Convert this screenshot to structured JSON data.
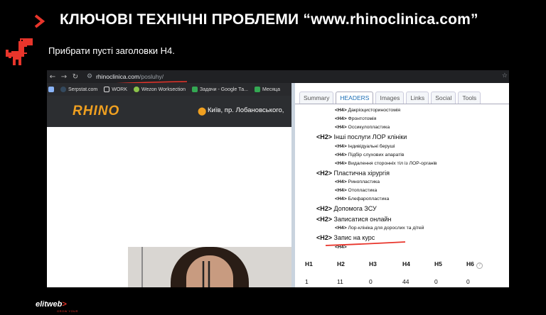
{
  "slide": {
    "title": "КЛЮЧОВІ ТЕХНІЧНІ ПРОБЛЕМИ “www.rhinoclinica.com”",
    "subtitle": "Прибрати пусті заголовки H4.",
    "accent_color": "#e8352b"
  },
  "browser": {
    "url_host": "rhinoclinica.com",
    "url_path": "/posluhy/",
    "bookmarks": [
      "Serpstat.com",
      "WORK",
      "Wezon Worksection",
      "Задачи - Google Та...",
      "Месяца"
    ]
  },
  "site": {
    "logo": "RHINO",
    "address": "Київ, пр. Лобановського,"
  },
  "seo_panel": {
    "tabs": [
      "Summary",
      "HEADERS",
      "Images",
      "Links",
      "Social",
      "Tools"
    ],
    "active_tab": "HEADERS",
    "headings": [
      {
        "level": "H4",
        "text": "Дакріоцисториностомія"
      },
      {
        "level": "H4",
        "text": "Фронтотомія"
      },
      {
        "level": "H4",
        "text": "Оссикулопластика"
      },
      {
        "level": "H2",
        "text": "Інші послуги ЛОР клініки"
      },
      {
        "level": "H4",
        "text": "Індивідуальні беруші"
      },
      {
        "level": "H4",
        "text": "Підбір слухових апаратів"
      },
      {
        "level": "H4",
        "text": "Видалення сторонніх тіл із ЛОР-органів"
      },
      {
        "level": "H2",
        "text": "Пластична хірургія"
      },
      {
        "level": "H4",
        "text": "Ринопластика"
      },
      {
        "level": "H4",
        "text": "Отопластика"
      },
      {
        "level": "H4",
        "text": "Блефаропластика"
      },
      {
        "level": "H2",
        "text": "Допомога ЗСУ"
      },
      {
        "level": "H2",
        "text": "Записатися онлайн"
      },
      {
        "level": "H4",
        "text": "Лор-клініка для дорослих та дітей"
      },
      {
        "level": "H2",
        "text": "Запис на курс"
      },
      {
        "level": "H4",
        "text": ""
      }
    ],
    "counts_header": [
      "H1",
      "H2",
      "H3",
      "H4",
      "H5",
      "H6"
    ],
    "counts": [
      "1",
      "11",
      "0",
      "44",
      "0",
      "0"
    ]
  },
  "footer": {
    "brand": "elitweb",
    "tagline": "GROW YOUR"
  }
}
